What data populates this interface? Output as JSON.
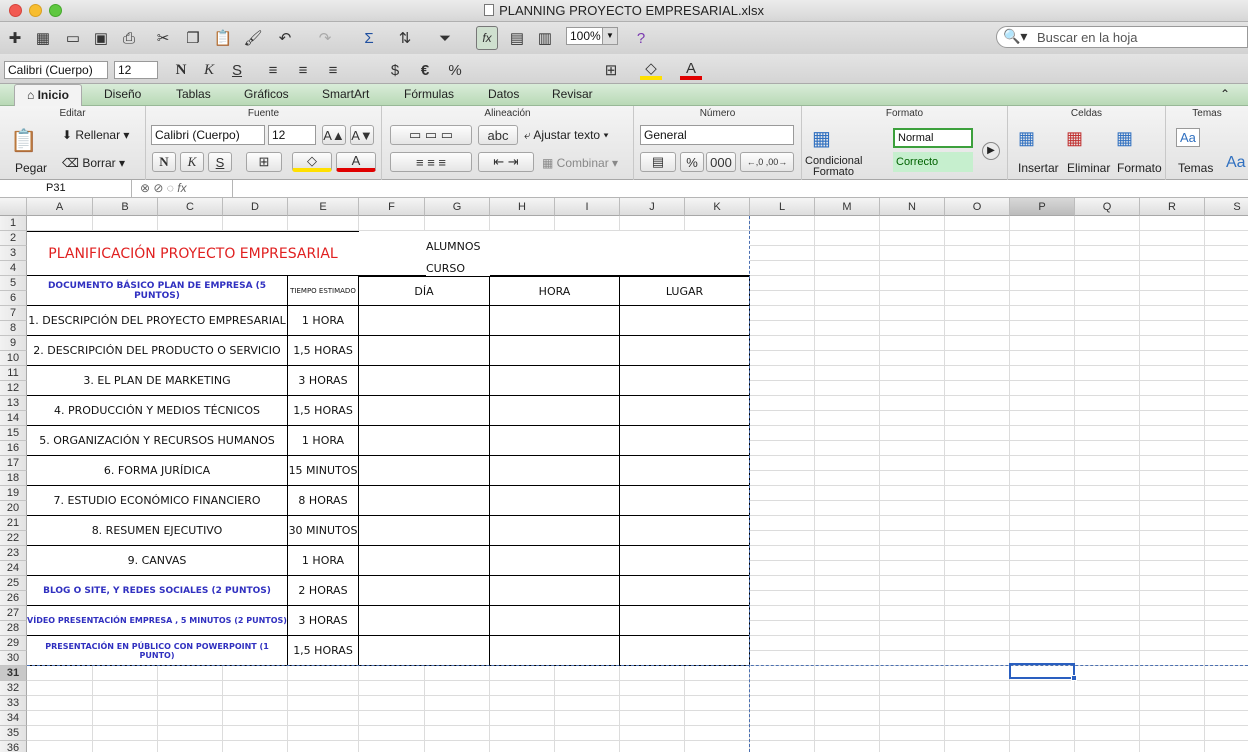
{
  "window": {
    "title": "PLANNING PROYECTO EMPRESARIAL.xlsx"
  },
  "toolbar": {
    "zoom": "100%",
    "search_placeholder": "Buscar en la hoja"
  },
  "format_bar": {
    "font": "Calibri (Cuerpo)",
    "size": "12",
    "bold": "N",
    "italic": "K",
    "underline": "S"
  },
  "tabs": [
    "Inicio",
    "Diseño",
    "Tablas",
    "Gráficos",
    "SmartArt",
    "Fórmulas",
    "Datos",
    "Revisar"
  ],
  "ribbon": {
    "groups": [
      "Editar",
      "Fuente",
      "Alineación",
      "Número",
      "Formato",
      "Celdas",
      "Temas"
    ],
    "pegar": "Pegar",
    "rellenar": "Rellenar",
    "borrar": "Borrar",
    "font": "Calibri (Cuerpo)",
    "size": "12",
    "bold": "N",
    "italic": "K",
    "underline": "S",
    "abc": "abc",
    "ajustar": "Ajustar texto",
    "combinar": "Combinar",
    "number_format": "General",
    "percent": "%",
    "thousands": "000",
    "condicional": "Condicional",
    "formato_btn": "Formato",
    "style_normal": "Normal",
    "style_correcto": "Correcto",
    "insertar": "Insertar",
    "eliminar": "Eliminar",
    "formato_cells": "Formato",
    "temas": "Temas",
    "aa": "Aa"
  },
  "formula_bar": {
    "cell_ref": "P31",
    "fx": "fx",
    "value": ""
  },
  "columns": [
    "A",
    "B",
    "C",
    "D",
    "E",
    "F",
    "G",
    "H",
    "I",
    "J",
    "K",
    "L",
    "M",
    "N",
    "O",
    "P",
    "Q",
    "R",
    "S"
  ],
  "rows": [
    "1",
    "2",
    "3",
    "4",
    "5",
    "6",
    "7",
    "8",
    "9",
    "10",
    "11",
    "12",
    "13",
    "14",
    "15",
    "16",
    "17",
    "18",
    "19",
    "20",
    "21",
    "22",
    "23",
    "24",
    "25",
    "26",
    "27",
    "28",
    "29",
    "30",
    "31",
    "32",
    "33",
    "34",
    "35",
    "36"
  ],
  "sheet": {
    "title": "PLANIFICACIÓN PROYECTO EMPRESARIAL",
    "alumnos": "ALUMNOS",
    "curso": "CURSO",
    "header_doc": "DOCUMENTO BÁSICO PLAN DE EMPRESA (5 PUNTOS)",
    "header_tiempo": "TIEMPO  ESTIMADO",
    "header_dia": "DÍA",
    "header_hora": "HORA",
    "header_lugar": "LUGAR",
    "tasks": [
      {
        "name": "1. DESCRIPCIÓN DEL PROYECTO EMPRESARIAL",
        "time": "1 HORA"
      },
      {
        "name": "2. DESCRIPCIÓN DEL PRODUCTO O SERVICIO",
        "time": "1,5 HORAS"
      },
      {
        "name": "3. EL PLAN DE MARKETING",
        "time": "3 HORAS"
      },
      {
        "name": "4. PRODUCCIÓN Y MEDIOS TÉCNICOS",
        "time": "1,5 HORAS"
      },
      {
        "name": "5. ORGANIZACIÓN Y RECURSOS HUMANOS",
        "time": "1 HORA"
      },
      {
        "name": "6. FORMA JURÍDICA",
        "time": "15 MINUTOS"
      },
      {
        "name": "7. ESTUDIO ECONÓMICO FINANCIERO",
        "time": "8 HORAS"
      },
      {
        "name": "8. RESUMEN EJECUTIVO",
        "time": "30 MINUTOS"
      },
      {
        "name": "9. CANVAS",
        "time": "1 HORA"
      },
      {
        "name": "BLOG O SITE, Y REDES SOCIALES  (2 PUNTOS)",
        "time": "2 HORAS"
      },
      {
        "name": "VÍDEO PRESENTACIÓN EMPRESA , 5 MINUTOS (2 PUNTOS)",
        "time": "3 HORAS"
      },
      {
        "name": "PRESENTACIÓN EN PÚBLICO CON POWERPOINT (1 PUNTO)",
        "time": "1,5 HORAS"
      }
    ]
  },
  "colors": {
    "title_red": "#e02020",
    "blue_text": "#3030c0",
    "tab_green": "#b9d9b6",
    "selection": "#2a5fc0"
  }
}
